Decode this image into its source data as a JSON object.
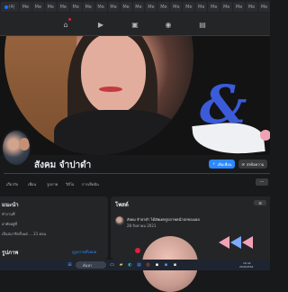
{
  "browser": {
    "first_tab_label": "(4)",
    "tab_labels": [
      "Me",
      "Me",
      "Me",
      "Me",
      "Me",
      "Me",
      "Me",
      "Me",
      "Me",
      "Me",
      "Me",
      "Me",
      "Me",
      "Me",
      "Me",
      "Me",
      "Me",
      "Me",
      "Me",
      "Me"
    ]
  },
  "fb_nav": {
    "icons": [
      "home-icon",
      "video-icon",
      "marketplace-icon",
      "groups-icon",
      "gaming-icon"
    ]
  },
  "profile": {
    "name": "สังคม จำปาดำ",
    "add_friend_label": "เพิ่มเพื่อน",
    "message_label": "ส่งข้อความ"
  },
  "profile_tabs": [
    "เกี่ยวกับ",
    "เพื่อน",
    "รูปภาพ",
    "วิดีโอ",
    "การเช็คอิน"
  ],
  "more_tab": "···",
  "intro": {
    "title": "แนะนำ",
    "line1": "ทำงานที่",
    "line2": "อาศัยอยู่ที่",
    "line3": "เป็นสมาชิกตั้งแต่ ... 21 ตอน",
    "footer_title": "รูปภาพ",
    "see_all_photos": "ดูรูปภาพทั้งหมด"
  },
  "posts": {
    "title": "โพสต์",
    "filter_label": "ตัวกรอง",
    "author_line": "สังคม จำปาดำ ได้อัพเดทรูปภาพหน้าปกของเธอ",
    "date_line": "28 สิงหาคม 2021"
  },
  "taskbar": {
    "search_placeholder": "ค้นหา",
    "clock_lines": [
      "16:42",
      "26/8/2564"
    ]
  },
  "colors": {
    "primary_blue": "#2d88ff",
    "surface": "#242526",
    "background": "#18191a"
  }
}
